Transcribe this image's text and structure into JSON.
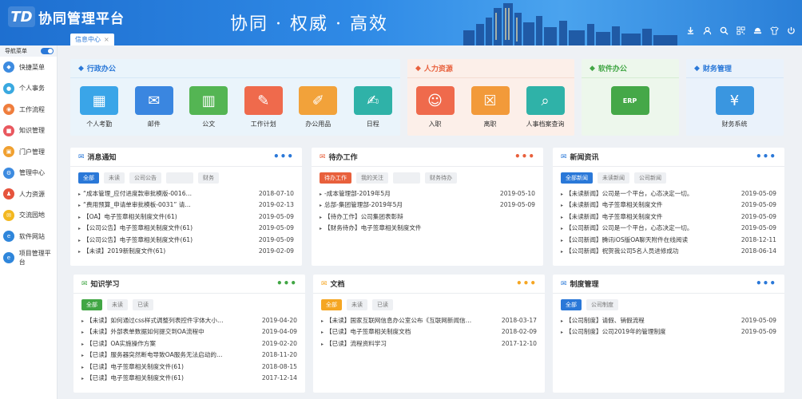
{
  "header": {
    "logo_mark": "TD",
    "app_title": "协同管理平台",
    "slogan": "协同 · 权威 · 高效",
    "tab_label": "信息中心",
    "tab_close": "×",
    "tools": [
      "download-icon",
      "user-icon",
      "search-icon",
      "qrcode-icon",
      "skin-icon",
      "shirt-icon",
      "power-icon"
    ]
  },
  "sidebar": {
    "nav_label": "导航菜单",
    "items": [
      {
        "label": "快捷菜单",
        "color": "#3d8be0",
        "icon": "◆"
      },
      {
        "label": "个人事务",
        "color": "#3aa9e0",
        "icon": "●"
      },
      {
        "label": "工作流程",
        "color": "#ef7d3c",
        "icon": "◉"
      },
      {
        "label": "知识管理",
        "color": "#e9585f",
        "icon": "■"
      },
      {
        "label": "门户管理",
        "color": "#f0a030",
        "icon": "▣"
      },
      {
        "label": "管理中心",
        "color": "#3d8be0",
        "icon": "⚙"
      },
      {
        "label": "人力资源",
        "color": "#e6543d",
        "icon": "♟"
      },
      {
        "label": "交流园地",
        "color": "#f3b820",
        "icon": "✉"
      },
      {
        "label": "软件网站",
        "color": "#2f86db",
        "icon": "e"
      },
      {
        "label": "项目管理平台",
        "color": "#2f86db",
        "icon": "e"
      }
    ]
  },
  "colors": {
    "xz": "#2a78d8",
    "rl": "#e8603c",
    "rj": "#41a644",
    "cw": "#2a78d8",
    "yellow": "#f5a623"
  },
  "admin": {
    "title": "行政办公",
    "apps": [
      {
        "label": "个人考勤",
        "color": "#3aa5e8",
        "icon": "▦"
      },
      {
        "label": "邮件",
        "color": "#3a86e0",
        "icon": "✉"
      },
      {
        "label": "公文",
        "color": "#54b553",
        "icon": "▥"
      },
      {
        "label": "工作计划",
        "color": "#ef6a4c",
        "icon": "✎"
      },
      {
        "label": "办公用品",
        "color": "#f2a23a",
        "icon": "✐"
      },
      {
        "label": "日程",
        "color": "#2fb2a8",
        "icon": "✍"
      }
    ]
  },
  "hr": {
    "title": "人力资源",
    "apps": [
      {
        "label": "入职",
        "color": "#ef6a4c",
        "icon": "☺"
      },
      {
        "label": "离职",
        "color": "#f29a3a",
        "icon": "☒"
      },
      {
        "label": "人事档案查询",
        "color": "#2fb2a8",
        "icon": "⌕"
      }
    ]
  },
  "software": {
    "title": "软件办公",
    "apps": [
      {
        "label": "",
        "color": "#45a848",
        "icon": "ERP"
      }
    ]
  },
  "finance": {
    "title": "财务管理",
    "apps": [
      {
        "label": "财务系统",
        "color": "#3a96e0",
        "icon": "¥"
      }
    ]
  },
  "notices": {
    "title": "消息通知",
    "more": "•••",
    "chips": [
      "全部",
      "未读",
      "公司公告",
      "",
      "财务"
    ],
    "rows": [
      {
        "text": "“成本管理_应付进度款审批模版-0016…",
        "date": "2018-07-10"
      },
      {
        "text": "“费用预算_申请单审批模板-0031” 请…",
        "date": "2019-02-13"
      },
      {
        "text": "【OA】电子签章相关制度文件(61)",
        "date": "2019-05-09"
      },
      {
        "text": "【公司公告】电子签章相关制度文件(61)",
        "date": "2019-05-09"
      },
      {
        "text": "【公司公告】电子签章相关制度文件(61)",
        "date": "2019-05-09"
      },
      {
        "text": "【未读】2019新制度文件(61)",
        "date": "2019-02-09"
      }
    ]
  },
  "todo": {
    "title": "待办工作",
    "more": "•••",
    "chips": [
      "待办工作",
      "我的关注",
      "",
      "财务待办"
    ],
    "rows": [
      {
        "text": "-成本管理部-2019年5月",
        "date": "2019-05-10"
      },
      {
        "text": "总部-集团管理部-2019年5月",
        "date": "2019-05-09"
      },
      {
        "text": "【待办工作】公司集团表彰辩",
        "date": ""
      },
      {
        "text": "【财务待办】电子签章相关制度文件",
        "date": ""
      }
    ]
  },
  "news": {
    "title": "新闻资讯",
    "more": "•••",
    "chips": [
      "全部新闻",
      "未读新闻",
      "公司新闻"
    ],
    "rows": [
      {
        "text": "【未读新闻】公司是一个平台，心态决定一切。",
        "date": "2019-05-09"
      },
      {
        "text": "【未读新闻】电子签章相关制度文件",
        "date": "2019-05-09"
      },
      {
        "text": "【未读新闻】电子签章相关制度文件",
        "date": "2019-05-09"
      },
      {
        "text": "【公司新闻】公司是一个平台，心态决定一切。",
        "date": "2019-05-09"
      },
      {
        "text": "【公司新闻】腾讯iOS版OA聊天附件在线阅读",
        "date": "2018-12-11"
      },
      {
        "text": "【公司新闻】祝贺我公司5名人员进修成功",
        "date": "2018-06-14"
      }
    ]
  },
  "knowledge": {
    "title": "知识学习",
    "more": "•••",
    "chips": [
      "全部",
      "未读",
      "已读"
    ],
    "rows": [
      {
        "text": "【未读】如何通过css样式调整列表控件字体大小…",
        "date": "2019-04-20"
      },
      {
        "text": "【未读】外部表单数据如何提交到OA流程中",
        "date": "2019-04-09"
      },
      {
        "text": "【已读】OA实施操作方案",
        "date": "2019-02-20"
      },
      {
        "text": "【已读】服务器突然断电导致OA服务无法启动的…",
        "date": "2018-11-20"
      },
      {
        "text": "【已读】电子签章相关制度文件(61)",
        "date": "2018-08-15"
      },
      {
        "text": "【已读】电子签章相关制度文件(61)",
        "date": "2017-12-14"
      }
    ]
  },
  "docs": {
    "title": "文档",
    "more": "•••",
    "chips": [
      "全部",
      "未读",
      "已读"
    ],
    "rows": [
      {
        "text": "【未读】国家互联网信息办公室公布《互联网新闻信…",
        "date": "2018-03-17"
      },
      {
        "text": "【已读】电子签章相关制度文档",
        "date": "2018-02-09"
      },
      {
        "text": "【已读】流程资料学习",
        "date": "2017-12-10"
      }
    ]
  },
  "rules": {
    "title": "制度管理",
    "more": "•••",
    "chips": [
      "全部",
      "公司制度"
    ],
    "rows": [
      {
        "text": "【公司制度】请假、销假流程",
        "date": "2019-05-09"
      },
      {
        "text": "【公司制度】公司2019年的管理制度",
        "date": "2019-05-09"
      }
    ]
  }
}
